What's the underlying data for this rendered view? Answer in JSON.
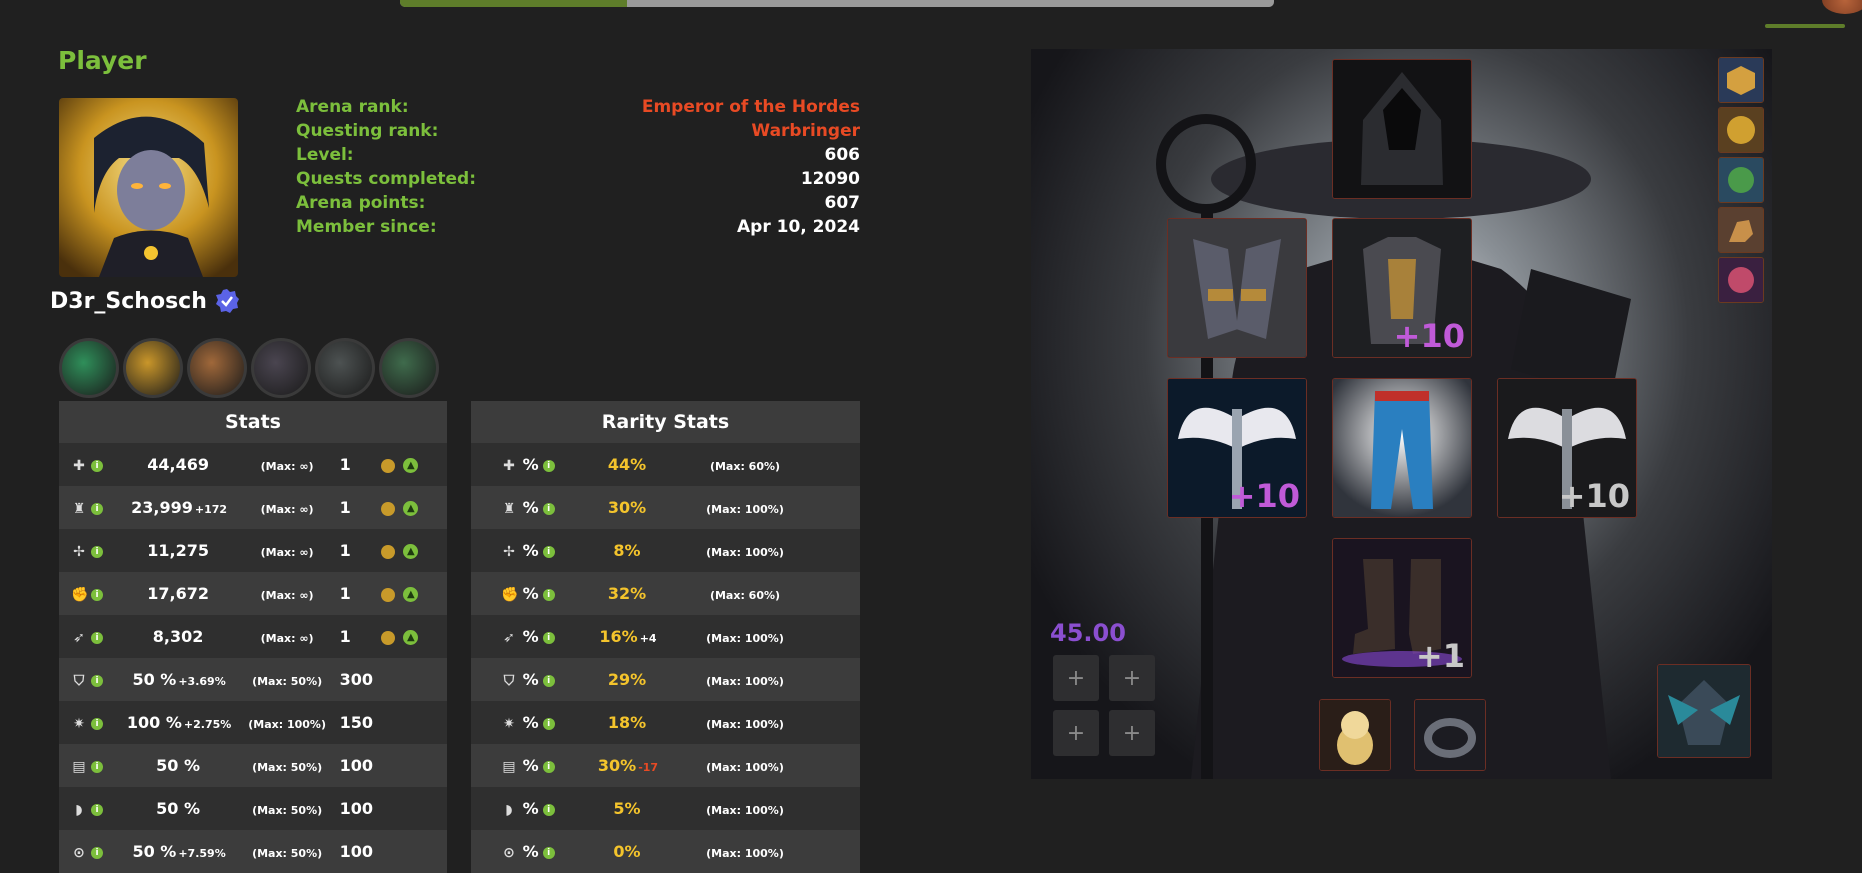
{
  "top_progress": {
    "percent": 26
  },
  "player": {
    "section_title": "Player",
    "username": "D3r_Schosch",
    "info": [
      {
        "label": "Arena rank:",
        "value": "Emperor of the Hordes",
        "highlight": true
      },
      {
        "label": "Questing rank:",
        "value": "Warbringer",
        "highlight": true
      },
      {
        "label": "Level:",
        "value": "606",
        "highlight": false
      },
      {
        "label": "Quests completed:",
        "value": "12090",
        "highlight": false
      },
      {
        "label": "Arena points:",
        "value": "607",
        "highlight": false
      },
      {
        "label": "Member since:",
        "value": "Apr 10, 2024",
        "highlight": false
      }
    ],
    "badge_colors": [
      "#2f8f5a",
      "#c9962a",
      "#a0683a",
      "#4a4550",
      "#4d5252",
      "#3f6b4c"
    ]
  },
  "stats": {
    "title": "Stats",
    "rows": [
      {
        "icon": "health-icon",
        "glyph": "✚",
        "value": "44,469",
        "bonus": "",
        "max": "(Max: ∞)",
        "level": "1",
        "upgrade": true
      },
      {
        "icon": "armor-icon",
        "glyph": "♜",
        "value": "23,999",
        "bonus": "+172",
        "max": "(Max: ∞)",
        "level": "1",
        "upgrade": true
      },
      {
        "icon": "damage-icon",
        "glyph": "✢",
        "value": "11,275",
        "bonus": "",
        "max": "(Max: ∞)",
        "level": "1",
        "upgrade": true
      },
      {
        "icon": "strength-icon",
        "glyph": "✊",
        "value": "17,672",
        "bonus": "",
        "max": "(Max: ∞)",
        "level": "1",
        "upgrade": true
      },
      {
        "icon": "attack-icon",
        "glyph": "➶",
        "value": "8,302",
        "bonus": "",
        "max": "(Max: ∞)",
        "level": "1",
        "upgrade": true
      },
      {
        "icon": "block-icon",
        "glyph": "⛉",
        "value": "50 %",
        "bonus": "+3.69%",
        "max": "(Max: 50%)",
        "level": "300",
        "upgrade": false
      },
      {
        "icon": "critical-icon",
        "glyph": "✷",
        "value": "100 %",
        "bonus": "+2.75%",
        "max": "(Max: 100%)",
        "level": "150",
        "upgrade": false
      },
      {
        "icon": "speed-icon",
        "glyph": "▤",
        "value": "50 %",
        "bonus": "",
        "max": "(Max: 50%)",
        "level": "100",
        "upgrade": false
      },
      {
        "icon": "dodge-icon",
        "glyph": "◗",
        "value": "50 %",
        "bonus": "",
        "max": "(Max: 50%)",
        "level": "100",
        "upgrade": false
      },
      {
        "icon": "precision-icon",
        "glyph": "⊙",
        "value": "50 %",
        "bonus": "+7.59%",
        "max": "(Max: 50%)",
        "level": "100",
        "upgrade": false
      }
    ]
  },
  "rarity_stats": {
    "title": "Rarity Stats",
    "rows": [
      {
        "icon": "health-icon",
        "glyph": "✚",
        "value": "44%",
        "bonus": "",
        "bonus_negative": false,
        "max": "(Max: 60%)"
      },
      {
        "icon": "armor-icon",
        "glyph": "♜",
        "value": "30%",
        "bonus": "",
        "bonus_negative": false,
        "max": "(Max: 100%)"
      },
      {
        "icon": "damage-icon",
        "glyph": "✢",
        "value": "8%",
        "bonus": "",
        "bonus_negative": false,
        "max": "(Max: 100%)"
      },
      {
        "icon": "strength-icon",
        "glyph": "✊",
        "value": "32%",
        "bonus": "",
        "bonus_negative": false,
        "max": "(Max: 60%)"
      },
      {
        "icon": "attack-icon",
        "glyph": "➶",
        "value": "16%",
        "bonus": "+4",
        "bonus_negative": false,
        "max": "(Max: 100%)"
      },
      {
        "icon": "block-icon",
        "glyph": "⛉",
        "value": "29%",
        "bonus": "",
        "bonus_negative": false,
        "max": "(Max: 100%)"
      },
      {
        "icon": "critical-icon",
        "glyph": "✷",
        "value": "18%",
        "bonus": "",
        "bonus_negative": false,
        "max": "(Max: 100%)"
      },
      {
        "icon": "speed-icon",
        "glyph": "▤",
        "value": "30%",
        "bonus": "-17",
        "bonus_negative": true,
        "max": "(Max: 100%)"
      },
      {
        "icon": "dodge-icon",
        "glyph": "◗",
        "value": "5%",
        "bonus": "",
        "bonus_negative": false,
        "max": "(Max: 100%)"
      },
      {
        "icon": "precision-icon",
        "glyph": "⊙",
        "value": "0%",
        "bonus": "",
        "bonus_negative": false,
        "max": "(Max: 100%)"
      }
    ]
  },
  "equipment": {
    "score": "45.00",
    "plus_label": "+",
    "gloves_level": "",
    "chest_level": "+10",
    "left_weapon_level": "+10",
    "right_weapon_level": "+10",
    "boots_level": "+1"
  }
}
